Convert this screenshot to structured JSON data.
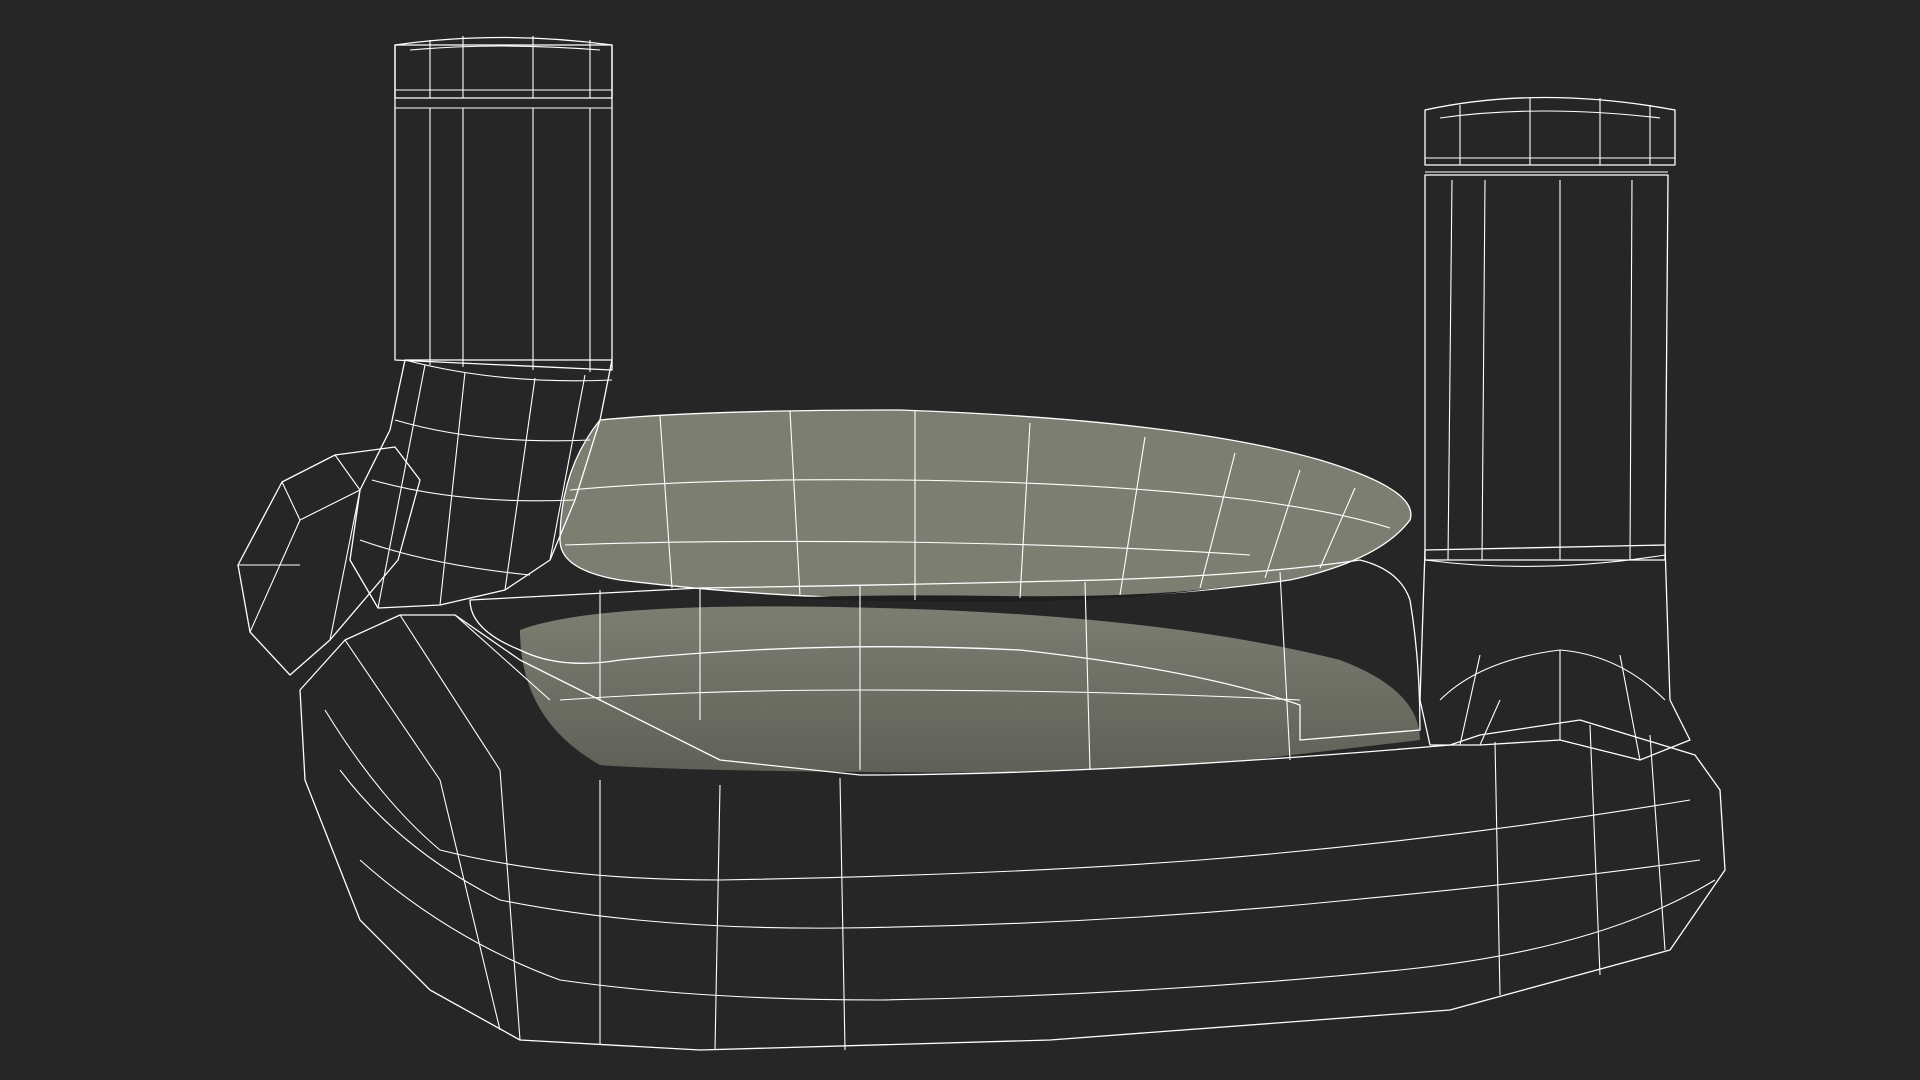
{
  "scene": {
    "subject": "wireframe-mesh",
    "background_color": "#262626",
    "surface_color": "#7b7c70",
    "surface_shadow_color": "#63645a",
    "wire_color": "#ffffff"
  }
}
